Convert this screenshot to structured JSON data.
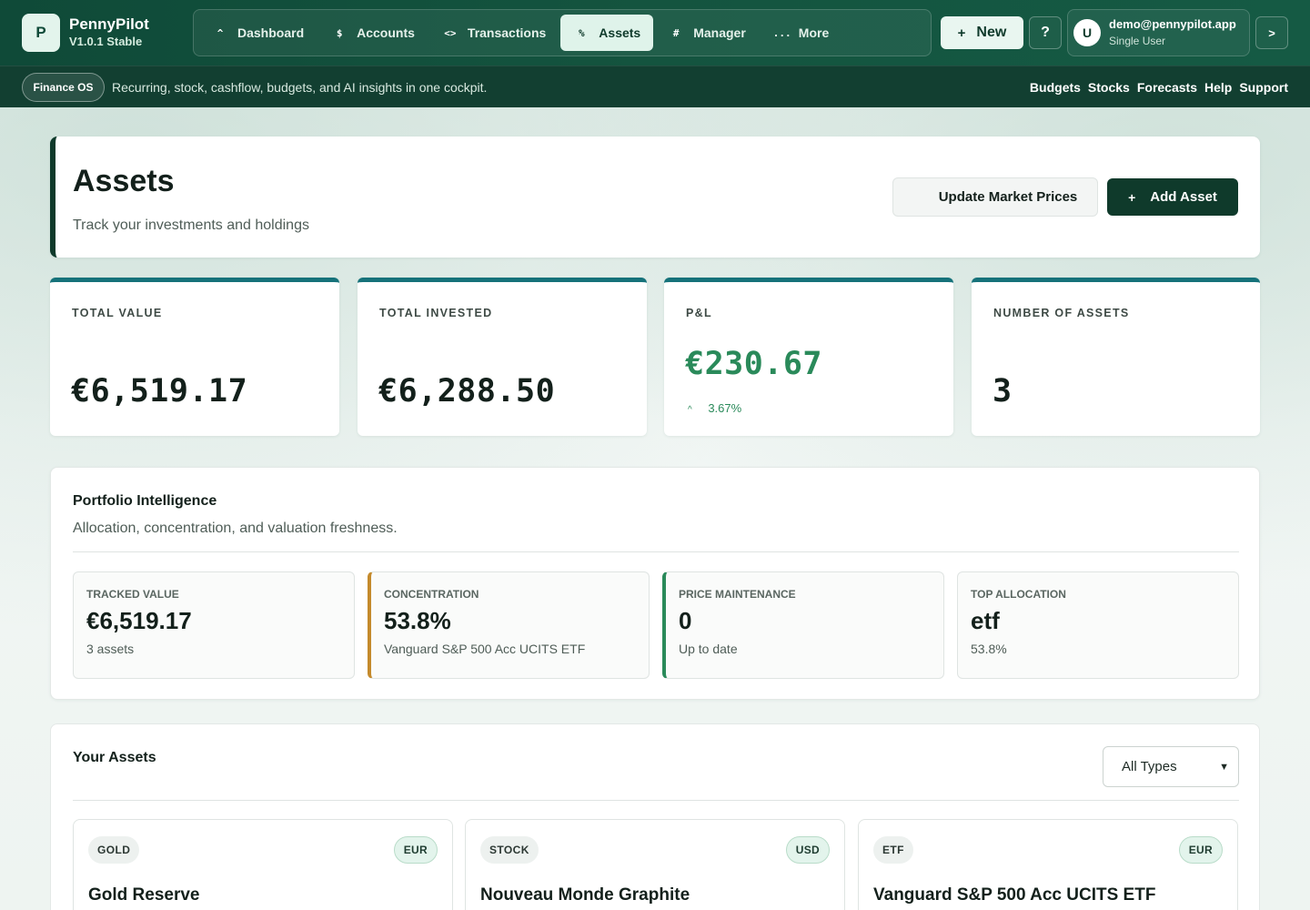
{
  "app": {
    "logo_letter": "P",
    "name": "PennyPilot",
    "version": "V1.0.1 Stable"
  },
  "nav": {
    "items": [
      {
        "icon": "^",
        "label": "Dashboard",
        "active": false
      },
      {
        "icon": "$",
        "label": "Accounts",
        "active": false
      },
      {
        "icon": "<>",
        "label": "Transactions",
        "active": false
      },
      {
        "icon": "%",
        "label": "Assets",
        "active": true
      },
      {
        "icon": "#",
        "label": "Manager",
        "active": false
      },
      {
        "icon": "...",
        "label": "More",
        "active": false
      }
    ]
  },
  "actions": {
    "new_icon": "+",
    "new_label": "New",
    "help_label": "?",
    "expand_label": ">"
  },
  "user": {
    "initial": "U",
    "email": "demo@pennypilot.app",
    "role": "Single User"
  },
  "subbar": {
    "pill": "Finance OS",
    "tagline": "Recurring, stock, cashflow, budgets, and AI insights in one cockpit.",
    "links": [
      "Budgets",
      "Stocks",
      "Forecasts",
      "Help",
      "Support"
    ]
  },
  "header": {
    "title": "Assets",
    "subtitle": "Track your investments and holdings",
    "update_label": "Update Market Prices",
    "add_icon": "+",
    "add_label": "Add Asset"
  },
  "stats": {
    "total_value": {
      "label": "TOTAL VALUE",
      "value": "€6,519.17"
    },
    "total_invested": {
      "label": "TOTAL INVESTED",
      "value": "€6,288.50"
    },
    "pnl": {
      "label": "P&L",
      "value": "€230.67",
      "change_icon": "^",
      "change": "3.67%"
    },
    "count": {
      "label": "NUMBER OF ASSETS",
      "value": "3"
    }
  },
  "intelligence": {
    "title": "Portfolio Intelligence",
    "subtitle": "Allocation, concentration, and valuation freshness.",
    "cards": [
      {
        "label": "TRACKED VALUE",
        "value": "€6,519.17",
        "sub": "3 assets"
      },
      {
        "label": "CONCENTRATION",
        "value": "53.8%",
        "sub": "Vanguard S&P 500 Acc UCITS ETF"
      },
      {
        "label": "PRICE MAINTENANCE",
        "value": "0",
        "sub": "Up to date"
      },
      {
        "label": "TOP ALLOCATION",
        "value": "etf",
        "sub": "53.8%"
      }
    ]
  },
  "assets": {
    "title": "Your Assets",
    "filter_selected": "All Types",
    "items": [
      {
        "type": "GOLD",
        "currency": "EUR",
        "name": "Gold Reserve"
      },
      {
        "type": "STOCK",
        "currency": "USD",
        "name": "Nouveau Monde Graphite"
      },
      {
        "type": "ETF",
        "currency": "EUR",
        "name": "Vanguard S&P 500 Acc UCITS ETF"
      }
    ]
  },
  "colors": {
    "brand_dark": "#0f3a2b",
    "topbar": "#14543f",
    "accent_teal": "#16727a",
    "positive": "#2a8a5a",
    "warning": "#c48a2c"
  }
}
